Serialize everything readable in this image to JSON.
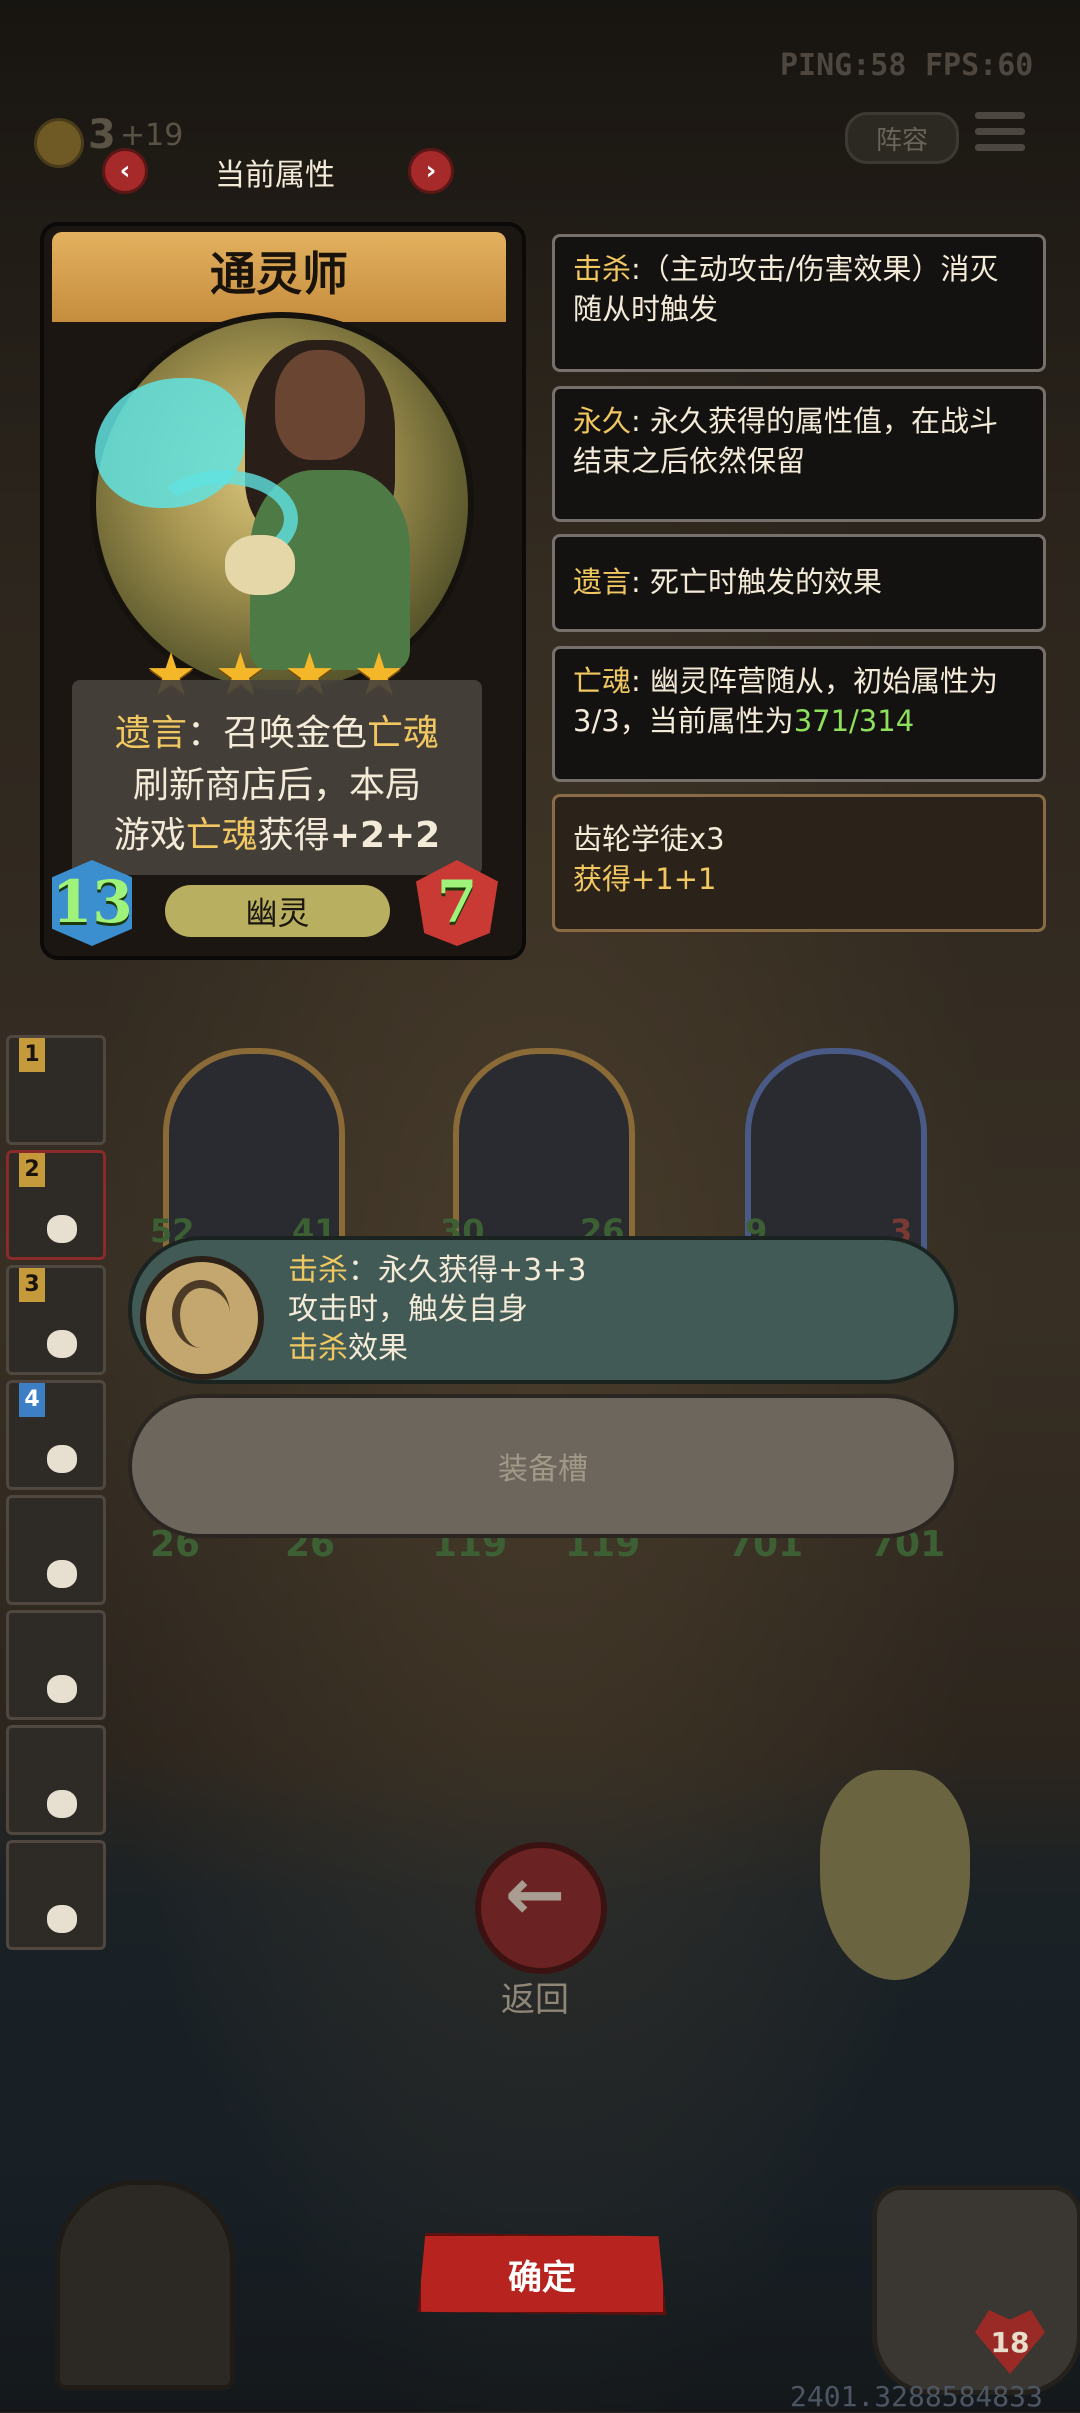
{
  "hud": {
    "ping": "PING:58",
    "fps": "FPS:60",
    "gold": "3",
    "gold_income": "+19",
    "lineup_label": "阵容"
  },
  "header": {
    "title": "当前属性"
  },
  "card": {
    "name": "通灵师",
    "stars": 4,
    "attack": "13",
    "health": "7",
    "tribe": "幽灵",
    "desc_line1": {
      "a": "遗言",
      "b": "：召唤金色",
      "c": "亡魂"
    },
    "desc_line2": "刷新商店后，本局",
    "desc_line3": {
      "a": "游戏",
      "b": "亡魂",
      "c": "获得",
      "d": "+2+2"
    }
  },
  "keywords": [
    {
      "key": "击杀",
      "text": ":（主动攻击/伤害效果）消灭随从时触发"
    },
    {
      "key": "永久",
      "text": ": 永久获得的属性值，在战斗结束之后依然保留"
    },
    {
      "key": "遗言",
      "text": ": 死亡时触发的效果"
    },
    {
      "key": "亡魂",
      "text": ": 幽灵阵营随从，初始属性为3/3，当前属性为",
      "value": "371/314"
    }
  ],
  "buff_box": {
    "line1": "齿轮学徒x3",
    "line2": "获得+1+1"
  },
  "board": {
    "stats_top": [
      "52",
      "41",
      "30",
      "26",
      "9",
      "3"
    ],
    "stats_bottom": [
      "26",
      "26",
      "119",
      "119",
      "701",
      "701"
    ]
  },
  "sidebar": {
    "numbers": [
      "1",
      "2",
      "3",
      "4"
    ]
  },
  "equipment": {
    "line1_key": "击杀",
    "line1_rest": "：永久获得+3+3",
    "line2": "攻击时，触发自身",
    "line3_key": "击杀",
    "line3_rest": "效果",
    "slot_label": "装备槽"
  },
  "footer": {
    "back_label": "返回",
    "confirm_label": "确定",
    "player_hp": "18",
    "version": "2401.3288584833"
  },
  "colors": {
    "gold_text": "#f0c760",
    "green_text": "#8ee05c",
    "confirm_red": "#b7231f"
  }
}
